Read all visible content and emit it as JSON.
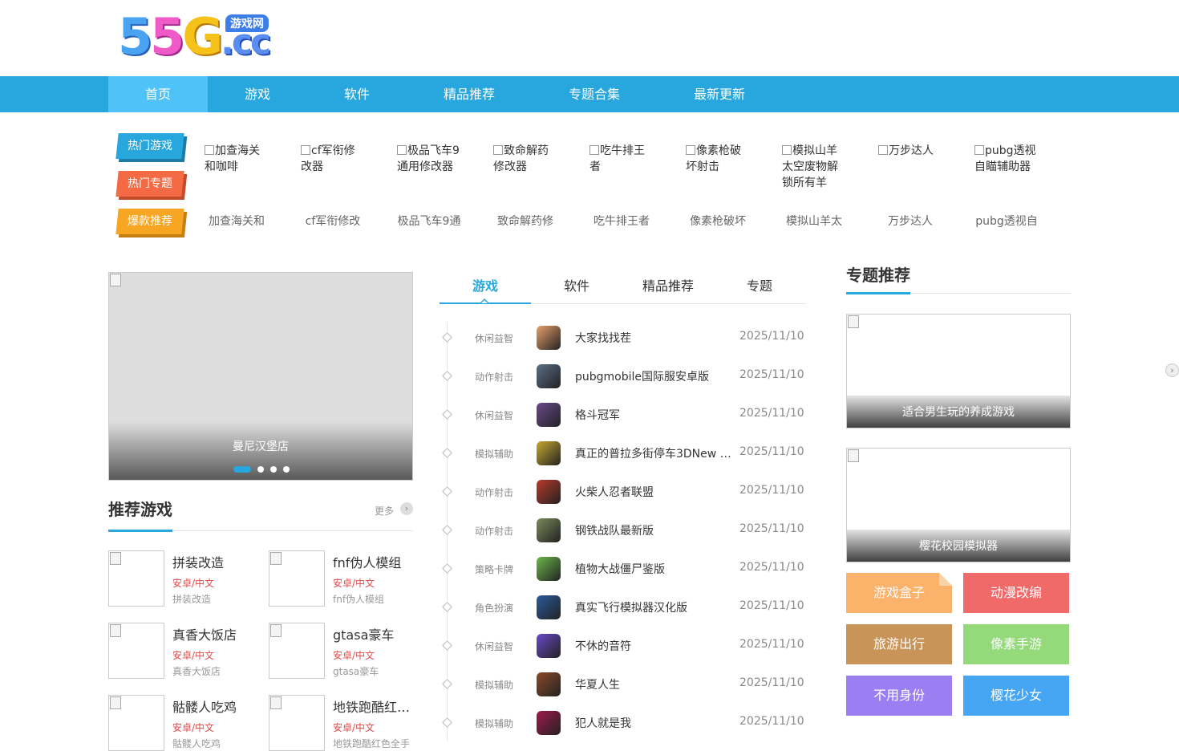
{
  "logo": {
    "big1": "5",
    "big2": "5",
    "big3": "G",
    "big4": ".cc",
    "badge": "游戏网"
  },
  "nav": [
    "首页",
    "游戏",
    "软件",
    "精品推荐",
    "专题合集",
    "最新更新"
  ],
  "hot": {
    "tags": [
      "热门游戏",
      "热门专题",
      "爆款推荐"
    ],
    "images": [
      "加查海关和咖啡",
      "cf军衔修改器",
      "极品飞车9通用修改器",
      "致命解药修改器",
      "吃牛排王者",
      "像素枪破坏射击",
      "模拟山羊太空废物解锁所有羊",
      "万步达人",
      "pubg透视自瞄辅助器"
    ],
    "texts": [
      "加查海关和",
      "cf军衔修改",
      "极品飞车9通",
      "致命解药修",
      "吃牛排王者",
      "像素枪破坏",
      "模拟山羊太",
      "万步达人",
      "pubg透视自"
    ]
  },
  "slider": {
    "caption": "曼尼汉堡店"
  },
  "recommend": {
    "title": "推荐游戏",
    "more": "更多",
    "items": [
      {
        "title": "拼装改造",
        "platform": "安卓/中文",
        "sub": "拼装改造"
      },
      {
        "title": "fnf伪人模组",
        "platform": "安卓/中文",
        "sub": "fnf伪人模组"
      },
      {
        "title": "真香大饭店",
        "platform": "安卓/中文",
        "sub": "真香大饭店"
      },
      {
        "title": "gtasa豪车",
        "platform": "安卓/中文",
        "sub": "gtasa豪车"
      },
      {
        "title": "骷髅人吃鸡",
        "platform": "安卓/中文",
        "sub": "骷髅人吃鸡"
      },
      {
        "title": "地铁跑酷红…",
        "platform": "安卓/中文",
        "sub": "地铁跑酷红色全手"
      }
    ]
  },
  "tabs": [
    "游戏",
    "软件",
    "精品推荐",
    "专题"
  ],
  "list": [
    {
      "cat": "休闲益智",
      "name": "大家找找茬",
      "date": "2025/11/10",
      "color": "#e7a06a"
    },
    {
      "cat": "动作射击",
      "name": "pubgmobile国际服安卓版",
      "date": "2025/11/10",
      "color": "#5b6e88"
    },
    {
      "cat": "休闲益智",
      "name": "格斗冠军",
      "date": "2025/11/10",
      "color": "#6a4a8c"
    },
    {
      "cat": "模拟辅助",
      "name": "真正的普拉多街停车3DNew L…",
      "date": "2025/11/10",
      "color": "#c8a830"
    },
    {
      "cat": "动作射击",
      "name": "火柴人忍者联盟",
      "date": "2025/11/10",
      "color": "#b83a2a"
    },
    {
      "cat": "动作射击",
      "name": "钢铁战队最新版",
      "date": "2025/11/10",
      "color": "#7a8a5a"
    },
    {
      "cat": "策略卡牌",
      "name": "植物大战僵尸鉴版",
      "date": "2025/11/10",
      "color": "#6cb84a"
    },
    {
      "cat": "角色扮演",
      "name": "真实飞行模拟器汉化版",
      "date": "2025/11/10",
      "color": "#2a5a9c"
    },
    {
      "cat": "休闲益智",
      "name": "不休的音符",
      "date": "2025/11/10",
      "color": "#6a4ac8"
    },
    {
      "cat": "模拟辅助",
      "name": "华夏人生",
      "date": "2025/11/10",
      "color": "#8a4a2a"
    },
    {
      "cat": "模拟辅助",
      "name": "犯人就是我",
      "date": "2025/11/10",
      "color": "#a01a4a"
    }
  ],
  "topics": {
    "title": "专题推荐",
    "cards": [
      "适合男生玩的养成游戏",
      "樱花校园模拟器"
    ],
    "buttons": [
      {
        "label": "游戏盒子",
        "color": "#fbb26b"
      },
      {
        "label": "动漫改编",
        "color": "#f06a6a"
      },
      {
        "label": "旅游出行",
        "color": "#c89458"
      },
      {
        "label": "像素手游",
        "color": "#94d97a"
      },
      {
        "label": "不用身份",
        "color": "#9b7ef2"
      },
      {
        "label": "樱花少女",
        "color": "#47a6f3"
      }
    ]
  }
}
